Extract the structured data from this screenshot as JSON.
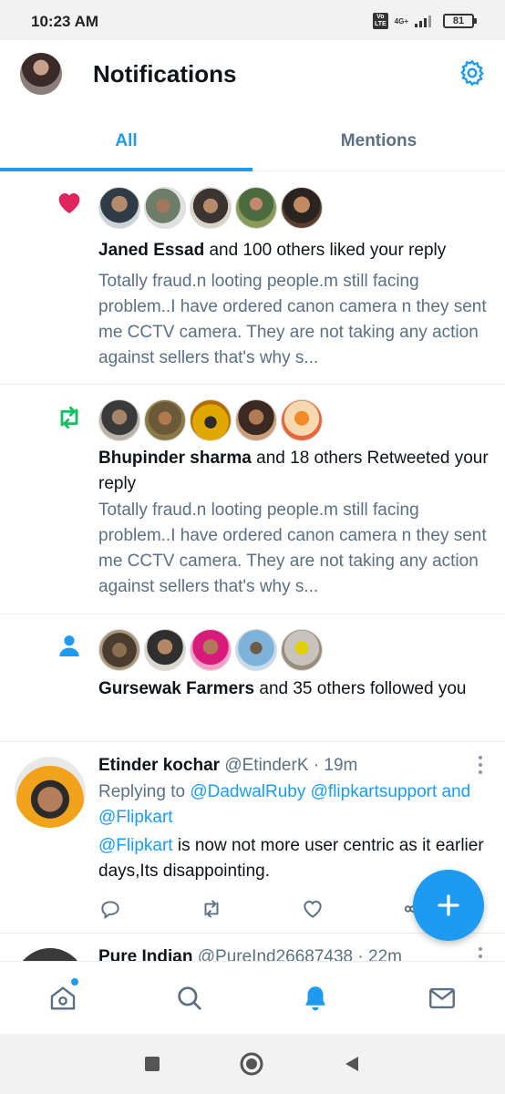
{
  "status_bar": {
    "time": "10:23 AM",
    "volte": "Vo\nLTE",
    "network": "4G+",
    "battery": "81"
  },
  "header": {
    "title": "Notifications",
    "settings_icon": "gear-icon",
    "accent": "#1d9bf0"
  },
  "tabs": [
    {
      "label": "All",
      "active": true
    },
    {
      "label": "Mentions",
      "active": false
    }
  ],
  "notifications": [
    {
      "type": "like",
      "icon": "heart-icon",
      "icon_color": "#e0245e",
      "actor": "Janed Essad",
      "action": " and 100 others liked your reply",
      "quote": "Totally fraud.n looting people.m still facing problem..I have ordered canon camera n they sent me CCTV camera. They are not taking any action against sellers that's why s..."
    },
    {
      "type": "retweet",
      "icon": "retweet-icon",
      "icon_color": "#17bf63",
      "actor": "Bhupinder sharma",
      "action": " and 18 others Retweeted your reply",
      "quote": "Totally fraud.n looting people.m still facing problem..I have ordered canon camera n they sent me CCTV camera. They are not taking any action against sellers that's why s..."
    },
    {
      "type": "follow",
      "icon": "person-icon",
      "icon_color": "#1d9bf0",
      "actor": "Gursewak Farmers",
      "action": " and 35 others followed you"
    }
  ],
  "tweets": [
    {
      "name": "Etinder kochar",
      "handle": "@EtinderK",
      "sep": " · ",
      "time": "19m",
      "replying_prefix": "Replying to ",
      "replying_to_1": "@DadwalRuby",
      "replying_space": " ",
      "replying_to_2": "@flipkartsupport",
      "replying_and": " and ",
      "replying_to_3": "@Flipkart",
      "body_mention": "@Flipkart",
      "body": " is now not more user centric as it earlier days,Its disappointing."
    },
    {
      "name": "Pure Indian",
      "handle": "@PureInd26687438",
      "sep": " · ",
      "time": "22m"
    }
  ]
}
